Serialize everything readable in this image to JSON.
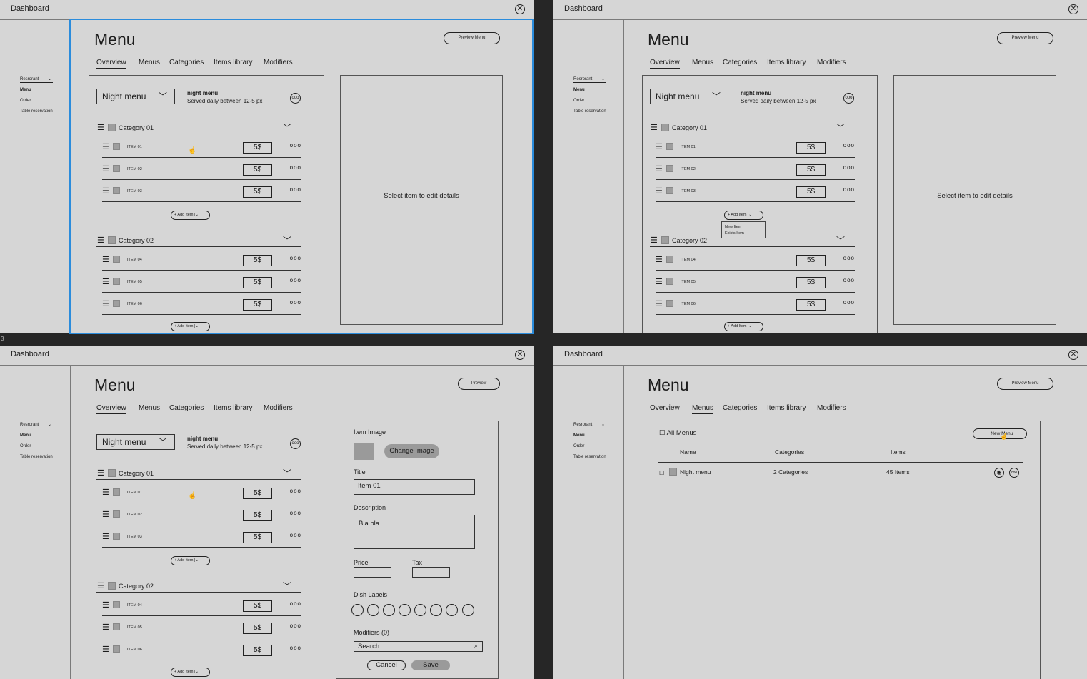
{
  "app": {
    "window_title": "Dashboard",
    "close_icon": "close-circle-icon"
  },
  "sidebar": {
    "selector": "Resrorant",
    "items": [
      "Menu",
      "Order",
      "Table reservation"
    ]
  },
  "page": {
    "title": "Menu",
    "preview_label": "Preview Menu",
    "preview_short_label": "Preview",
    "tabs": [
      "Overview",
      "Menus",
      "Categories",
      "Items library",
      "Modifiers"
    ]
  },
  "menu": {
    "selected": "Night menu",
    "name": "night menu",
    "description": "Served daily between 12-5 px"
  },
  "categories": [
    {
      "name": "Category 01",
      "items": [
        {
          "name": "ITEM 01",
          "price": "5$"
        },
        {
          "name": "ITEM 02",
          "price": "5$"
        },
        {
          "name": "ITEM 03",
          "price": "5$"
        }
      ]
    },
    {
      "name": "Category 02",
      "items": [
        {
          "name": "ITEM 04",
          "price": "5$"
        },
        {
          "name": "ITEM 05",
          "price": "5$"
        },
        {
          "name": "ITEM 06",
          "price": "5$"
        }
      ]
    }
  ],
  "add_item_label": "+ Add Item",
  "add_item_dropdown": {
    "options": [
      "New Item",
      "Exists Item"
    ]
  },
  "details_placeholder": "Select item to edit details",
  "item_editor": {
    "image_label": "Item Image",
    "change_image_label": "Change Image",
    "title_label": "Title",
    "title_value": "Item 01",
    "description_label": "Description",
    "description_value": "Bla bla",
    "price_label": "Price",
    "tax_label": "Tax",
    "dish_labels_label": "Dish Labels",
    "dish_label_count": 8,
    "modifiers_label": "Modifiers (0)",
    "search_placeholder": "Search",
    "cancel_label": "Cancel",
    "save_label": "Save"
  },
  "menus_list": {
    "all_menus_label": "All Menus",
    "new_menu_label": "+ New Menu",
    "columns": [
      "Name",
      "Categories",
      "Items"
    ],
    "rows": [
      {
        "name": "Night menu",
        "categories": "2 Categories",
        "items": "45 Items"
      }
    ]
  },
  "frame_number": "3",
  "colors": {
    "background": "#262626",
    "panel": "#d6d6d6",
    "selection": "#2b8cdc",
    "placeholder_gray": "#9a9a9a"
  }
}
